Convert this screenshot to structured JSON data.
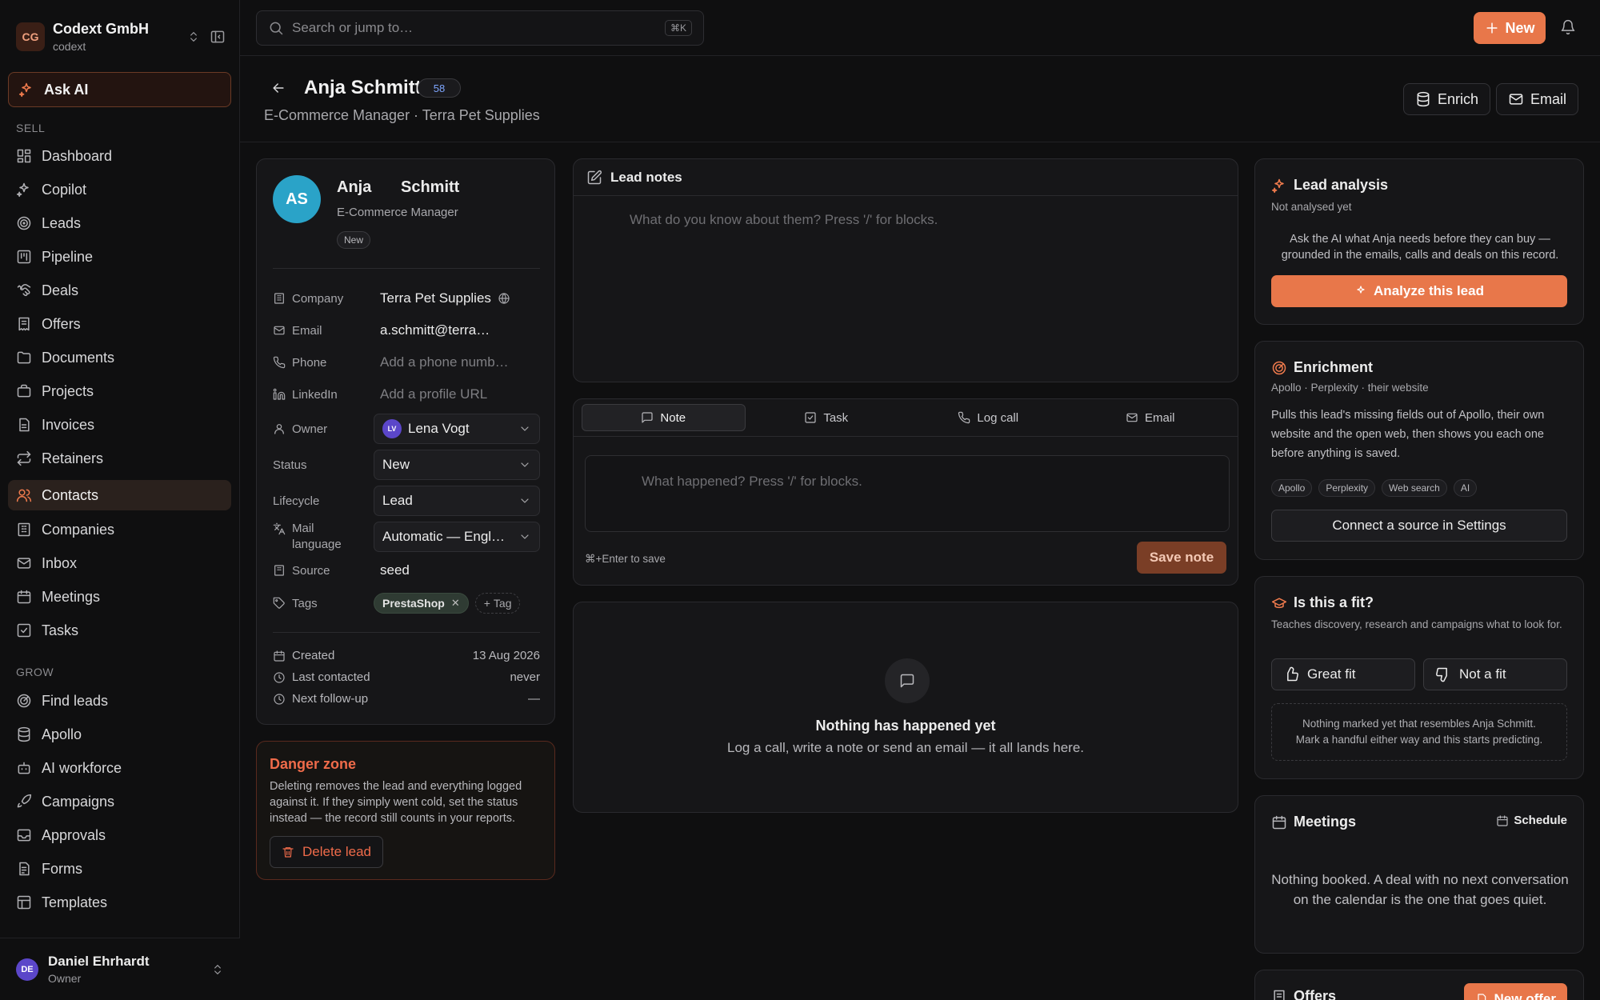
{
  "workspace": {
    "initials": "CG",
    "name": "Codext GmbH",
    "slug": "codext"
  },
  "ask_ai": "Ask AI",
  "nav": {
    "sell_label": "SELL",
    "sell": [
      "Dashboard",
      "Copilot",
      "Leads",
      "Pipeline",
      "Deals",
      "Offers",
      "Documents",
      "Projects",
      "Invoices",
      "Retainers",
      "Contacts",
      "Companies",
      "Inbox",
      "Meetings",
      "Tasks"
    ],
    "grow_label": "GROW",
    "grow": [
      "Find leads",
      "Apollo",
      "AI workforce",
      "Campaigns",
      "Approvals",
      "Forms",
      "Templates"
    ],
    "active": "Contacts"
  },
  "user": {
    "initials": "DE",
    "name": "Daniel Ehrhardt",
    "role": "Owner"
  },
  "search": {
    "placeholder": "Search or jump to…",
    "shortcut": "⌘K"
  },
  "new_button": "New",
  "header": {
    "name": "Anja Schmitt",
    "score": "58",
    "subtitle": "E-Commerce Manager · Terra Pet Supplies",
    "enrich": "Enrich",
    "email": "Email"
  },
  "profile": {
    "initials": "AS",
    "first_name": "Anja",
    "last_name": "Schmitt",
    "role": "E-Commerce Manager",
    "status_pill": "New",
    "fields": {
      "company_label": "Company",
      "company": "Terra Pet Supplies",
      "email_label": "Email",
      "email": "a.schmitt@terra…",
      "phone_label": "Phone",
      "phone_placeholder": "Add a phone numb…",
      "linkedin_label": "LinkedIn",
      "linkedin_placeholder": "Add a profile URL",
      "owner_label": "Owner",
      "owner_initials": "LV",
      "owner": "Lena Vogt",
      "status_label": "Status",
      "status": "New",
      "lifecycle_label": "Lifecycle",
      "lifecycle": "Lead",
      "mail_language_label": "Mail language",
      "mail_language": "Automatic — Engl…",
      "source_label": "Source",
      "source": "seed",
      "tags_label": "Tags",
      "tag": "PrestaShop",
      "tag_add": "Tag"
    },
    "meta": {
      "created_label": "Created",
      "created": "13 Aug 2026",
      "last_contacted_label": "Last contacted",
      "last_contacted": "never",
      "next_followup_label": "Next follow-up",
      "next_followup": "—"
    }
  },
  "danger": {
    "title": "Danger zone",
    "text": "Deleting removes the lead and everything logged against it. If they simply went cold, set the status instead — the record still counts in your reports.",
    "button": "Delete lead"
  },
  "notes": {
    "title": "Lead notes",
    "placeholder": "What do you know about them? Press '/' for blocks."
  },
  "composer": {
    "tabs": [
      "Note",
      "Task",
      "Log call",
      "Email"
    ],
    "placeholder": "What happened? Press '/' for blocks.",
    "hint": "⌘+Enter to save",
    "save": "Save note"
  },
  "activity": {
    "empty_title": "Nothing has happened yet",
    "empty_sub": "Log a call, write a note or send an email — it all lands here."
  },
  "lead_analysis": {
    "title": "Lead analysis",
    "status": "Not analysed yet",
    "body": "Ask the AI what Anja needs before they can buy — grounded in the emails, calls and deals on this record.",
    "button": "Analyze this lead"
  },
  "enrichment": {
    "title": "Enrichment",
    "sources": "Apollo · Perplexity · their website",
    "body": "Pulls this lead's missing fields out of Apollo, their own website and the open web, then shows you each one before anything is saved.",
    "chips": [
      "Apollo",
      "Perplexity",
      "Web search",
      "AI"
    ],
    "button": "Connect a source in Settings"
  },
  "fit": {
    "title": "Is this a fit?",
    "sub": "Teaches discovery, research and campaigns what to look for.",
    "great": "Great fit",
    "not": "Not a fit",
    "note_line1": "Nothing marked yet that resembles Anja Schmitt.",
    "note_line2": "Mark a handful either way and this starts predicting."
  },
  "meetings": {
    "title": "Meetings",
    "schedule": "Schedule",
    "body": "Nothing booked. A deal with no next conversation on the calendar is the one that goes quiet."
  },
  "offers": {
    "title": "Offers",
    "button": "New offer"
  },
  "colors": {
    "accent": "#e8774a",
    "danger": "#ef6b4a",
    "background": "#0f0f10",
    "card": "#161618"
  }
}
